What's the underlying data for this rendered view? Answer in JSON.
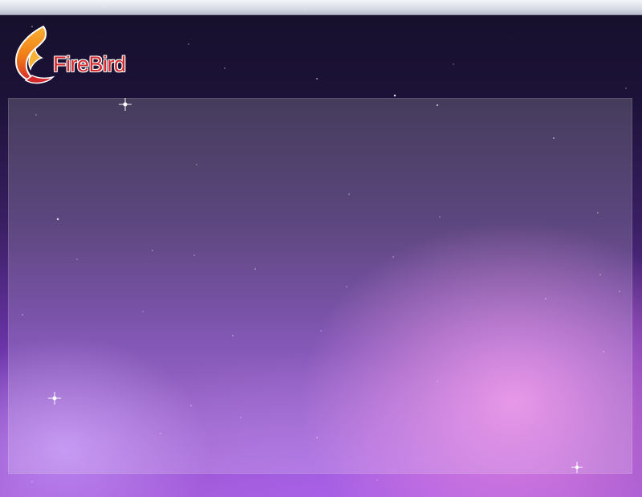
{
  "header": {
    "logo_text": "FireBird",
    "logo_icon": "firebird-flame-icon"
  },
  "colors": {
    "strip": "#d9dde6",
    "logo_text": "#d4282c",
    "flame_orange": "#f28a1a",
    "flame_red": "#d4282c",
    "panel_overlay": "rgba(255,255,255,0.18)"
  }
}
